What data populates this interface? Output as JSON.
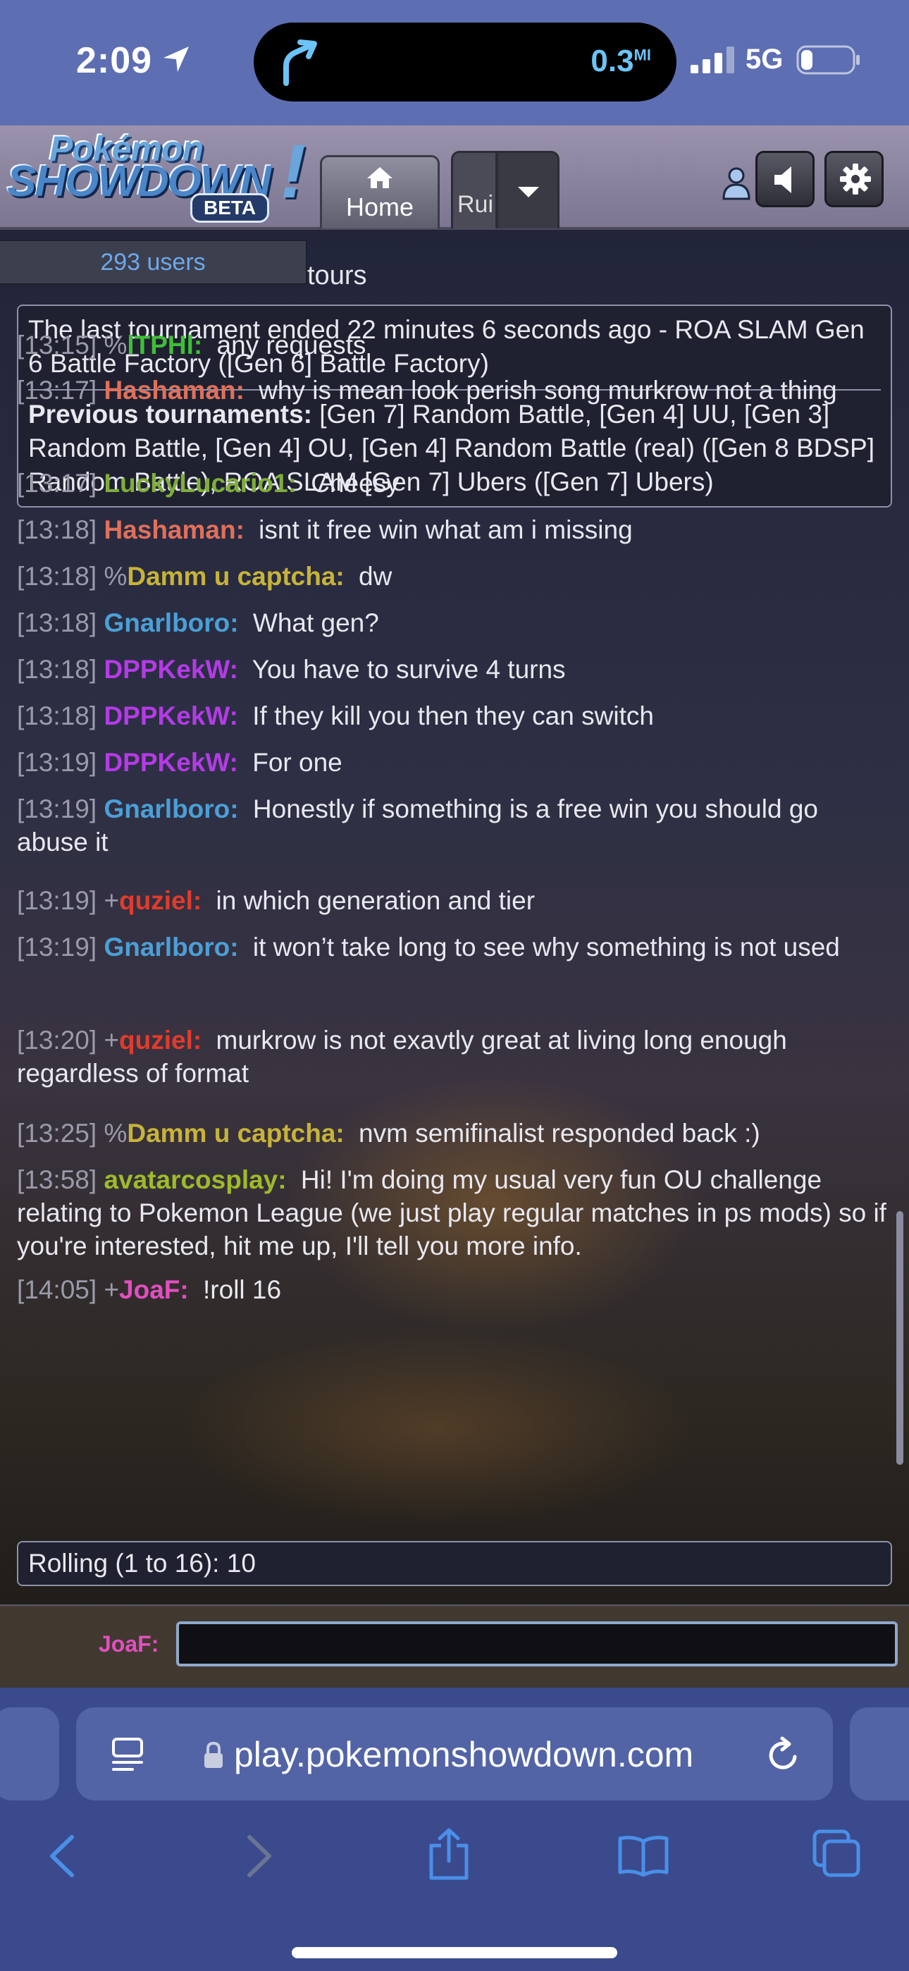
{
  "status_bar": {
    "time": "2:09",
    "distance": "0.3",
    "distance_unit": "MI",
    "network": "5G"
  },
  "header": {
    "logo_top": "Pokémon",
    "logo_main": "SHOWDOWN",
    "logo_badge": "BETA",
    "home_tab": "Home",
    "room_tab": "Rui"
  },
  "room": {
    "users_count": "293 users",
    "title_fragment": "tours",
    "tournament_last": "The last tournament ended 22 minutes 6 seconds ago - ROA SLAM Gen 6 Battle Factory ([Gen 6] Battle Factory)",
    "tournament_prev_label": "Previous tournaments:",
    "tournament_prev_list": " [Gen 7] Random Battle, [Gen 4] UU, [Gen 3] Random Battle, [Gen 4] OU, [Gen 4] Random Battle (real) ([Gen 8 BDSP] Random Battle), ROA SLAM [Gen 7] Ubers ([Gen 7] Ubers)"
  },
  "messages": [
    {
      "ts": "[13:15]",
      "rank": "%",
      "user": "lTPHl:",
      "color": "#3fbf38",
      "text": "any requests"
    },
    {
      "ts": "[13:17]",
      "rank": "",
      "user": "Hashaman:",
      "color": "#e0705a",
      "text": "why is mean look perish song murkrow not a thing"
    },
    {
      "ts": "[13:17]",
      "rank": "",
      "user": "LuckyLucario1:",
      "color": "#7fae3a",
      "text": "Cheesy"
    },
    {
      "ts": "[13:18]",
      "rank": "",
      "user": "Hashaman:",
      "color": "#e0705a",
      "text": "isnt it free win what am i missing"
    },
    {
      "ts": "[13:18]",
      "rank": "%",
      "user": "Damm u captcha:",
      "color": "#c7b33a",
      "text": "dw"
    },
    {
      "ts": "[13:18]",
      "rank": "",
      "user": "Gnarlboro:",
      "color": "#4b9fd6",
      "text": "What gen?"
    },
    {
      "ts": "[13:18]",
      "rank": "",
      "user": "DPPKekW:",
      "color": "#b43be6",
      "text": "You have to survive 4 turns"
    },
    {
      "ts": "[13:18]",
      "rank": "",
      "user": "DPPKekW:",
      "color": "#b43be6",
      "text": "If they kill you then they can switch"
    },
    {
      "ts": "[13:19]",
      "rank": "",
      "user": "DPPKekW:",
      "color": "#b43be6",
      "text": "For one"
    },
    {
      "ts": "[13:19]",
      "rank": "",
      "user": "Gnarlboro:",
      "color": "#4b9fd6",
      "text": "Honestly if something is a free win you should go abuse it"
    },
    {
      "ts": "[13:19]",
      "rank": "+",
      "user": "quziel:",
      "color": "#e23b2b",
      "text": "in which generation and tier"
    },
    {
      "ts": "[13:19]",
      "rank": "",
      "user": "Gnarlboro:",
      "color": "#4b9fd6",
      "text": "it won’t take long to see why something is not used"
    },
    {
      "ts": "[13:20]",
      "rank": "+",
      "user": "quziel:",
      "color": "#e23b2b",
      "text": "murkrow is not exavtly great at living long enough regardless of format"
    },
    {
      "ts": "[13:25]",
      "rank": "%",
      "user": "Damm u captcha:",
      "color": "#c7b33a",
      "text": "nvm semifinalist responded back :)"
    },
    {
      "ts": "[13:58]",
      "rank": "",
      "user": "avatarcosplay:",
      "color": "#9dbb2a",
      "text": "Hi! I'm doing my usual very fun OU challenge relating to Pokemon League (we just play regular matches in ps mods) so if you're interested, hit me up, I'll tell you more info."
    },
    {
      "ts": "[14:05]",
      "rank": "+",
      "user": "JoaF:",
      "color": "#e14fbf",
      "text": "!roll 16"
    }
  ],
  "roll_result": "Rolling (1 to 16): 10",
  "chatbox": {
    "username": "JoaF:",
    "value": ""
  },
  "safari": {
    "url": "play.pokemonshowdown.com"
  }
}
